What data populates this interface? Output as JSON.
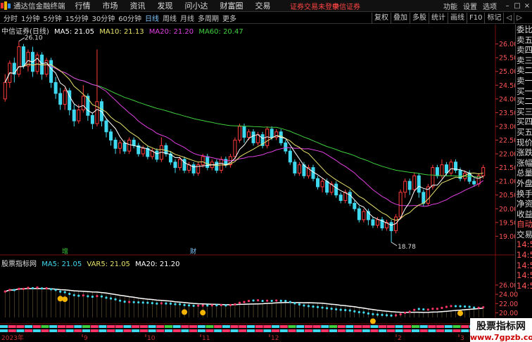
{
  "titlebar": {
    "app_title": "通达信金融终端",
    "menus": [
      "行情",
      "市场",
      "资讯",
      "发现",
      "问小达",
      "财富圈",
      "交易"
    ],
    "notice": "证券交易未登录",
    "broker": "中信证券",
    "right_menus": [
      "功能",
      "设置",
      "选项"
    ],
    "minimize": "–",
    "maximize": "□",
    "close": "×"
  },
  "toolbar": {
    "periods": [
      "分时",
      "1分钟",
      "5分钟",
      "15分钟",
      "30分钟",
      "60分钟",
      "日线",
      "周线",
      "月线",
      "多周期",
      "更多"
    ],
    "active_period": "日线",
    "tools": [
      "复权",
      "叠加",
      "多股",
      "统计",
      "画线",
      "F10",
      "标记",
      "◁",
      "▷"
    ]
  },
  "chart_title": {
    "stock": "中信证券(日线)",
    "ma5": "MA5: 21.05",
    "ma10": "MA10: 21.13",
    "ma20": "MA20: 21.20",
    "ma60": "MA60: 20.47"
  },
  "indicator_title": {
    "name": "股票指标网",
    "ma5": "MA5: 21.05",
    "var5": "VAR5: 21.05",
    "ma20": "MA20: 21.20"
  },
  "annotations": {
    "high": "26.10",
    "low": "18.78",
    "event1": "增",
    "event2": "财",
    "year": "2023年"
  },
  "x_labels": [
    "9",
    "10",
    "11",
    "12",
    "2",
    "3"
  ],
  "quote_panel": [
    "委比",
    "卖五",
    "卖四",
    "卖三",
    "卖二",
    "卖一",
    "买一",
    "买二",
    "买三",
    "买四",
    "买五",
    "现价",
    "涨跌",
    "涨幅",
    "总量",
    "外盘",
    "换手",
    "净资",
    "收益",
    "自动",
    "交易",
    "14:50",
    "14:50",
    "14:50",
    "14:50",
    "14:50",
    "14:50",
    "14:50",
    "14:50",
    "14:50"
  ],
  "watermark": {
    "line1": "股票指标网",
    "line2": "www.7gpzb.com"
  },
  "colors": {
    "up": "#ff3b3b",
    "down": "#3fd9ef",
    "ma5": "#ffffff",
    "ma10": "#e8e36a",
    "ma20": "#e040e0",
    "ma60": "#3ecf3e",
    "accent": "#7ec8ff"
  },
  "chart_data": [
    {
      "type": "candlestick",
      "title": "中信证券(日线)",
      "y_ticks": [
        26.0,
        25.5,
        25.0,
        24.5,
        24.0,
        23.5,
        23.0,
        22.5,
        22.0,
        21.5,
        21.0,
        20.5,
        20.0,
        19.5,
        19.0
      ],
      "ylim": [
        18.6,
        26.4
      ],
      "x_tick_labels": [
        "9",
        "10",
        "11",
        "12",
        "2",
        "3"
      ],
      "candles": [
        [
          24.0,
          24.6,
          24.9,
          23.9
        ],
        [
          24.6,
          25.3,
          25.4,
          24.4
        ],
        [
          25.3,
          24.9,
          25.5,
          24.6
        ],
        [
          24.9,
          25.9,
          26.1,
          24.8
        ],
        [
          25.9,
          25.2,
          26.0,
          25.1
        ],
        [
          25.2,
          25.7,
          25.8,
          25.0
        ],
        [
          25.7,
          25.0,
          25.9,
          24.8
        ],
        [
          25.0,
          25.6,
          25.7,
          24.9
        ],
        [
          25.6,
          24.9,
          25.7,
          24.7
        ],
        [
          24.9,
          25.4,
          25.5,
          24.8
        ],
        [
          25.4,
          24.6,
          25.5,
          24.4
        ],
        [
          24.6,
          24.2,
          24.8,
          24.0
        ],
        [
          24.2,
          23.8,
          24.4,
          23.6
        ],
        [
          23.8,
          24.3,
          24.4,
          23.6
        ],
        [
          24.3,
          23.6,
          24.4,
          23.4
        ],
        [
          23.6,
          23.2,
          23.8,
          23.0
        ],
        [
          23.2,
          23.6,
          23.8,
          23.1
        ],
        [
          23.6,
          24.1,
          24.5,
          23.5
        ],
        [
          24.1,
          23.4,
          24.2,
          23.2
        ],
        [
          23.4,
          23.1,
          23.5,
          22.9
        ],
        [
          23.1,
          23.9,
          25.8,
          23.0
        ],
        [
          23.9,
          23.2,
          24.0,
          23.0
        ],
        [
          23.2,
          22.8,
          23.3,
          22.6
        ],
        [
          22.8,
          22.5,
          22.9,
          22.3
        ],
        [
          22.5,
          22.2,
          22.6,
          22.0
        ],
        [
          22.2,
          22.4,
          22.5,
          22.0
        ],
        [
          22.4,
          22.1,
          22.5,
          22.0
        ],
        [
          22.1,
          22.5,
          22.6,
          22.0
        ],
        [
          22.5,
          22.3,
          22.6,
          22.2
        ],
        [
          22.3,
          22.0,
          22.4,
          21.9
        ],
        [
          22.0,
          22.2,
          22.3,
          21.9
        ],
        [
          22.2,
          21.9,
          22.3,
          21.8
        ],
        [
          21.9,
          22.1,
          22.2,
          21.8
        ],
        [
          22.1,
          21.8,
          22.2,
          21.7
        ],
        [
          21.8,
          22.3,
          22.6,
          21.7
        ],
        [
          22.3,
          22.0,
          22.4,
          21.9
        ],
        [
          22.0,
          21.7,
          22.1,
          21.6
        ],
        [
          21.7,
          21.5,
          21.8,
          21.3
        ],
        [
          21.5,
          21.8,
          21.9,
          21.4
        ],
        [
          21.8,
          21.4,
          21.9,
          21.3
        ],
        [
          21.4,
          21.6,
          21.7,
          21.3
        ],
        [
          21.6,
          21.3,
          21.7,
          21.2
        ],
        [
          21.3,
          21.6,
          21.7,
          21.2
        ],
        [
          21.6,
          21.9,
          22.0,
          21.5
        ],
        [
          21.9,
          21.5,
          22.0,
          21.4
        ],
        [
          21.5,
          21.7,
          21.8,
          21.4
        ],
        [
          21.7,
          21.4,
          21.8,
          21.3
        ],
        [
          21.4,
          21.8,
          21.9,
          21.3
        ],
        [
          21.8,
          21.6,
          21.9,
          21.5
        ],
        [
          21.6,
          21.9,
          22.0,
          21.5
        ],
        [
          21.9,
          22.5,
          22.6,
          21.8
        ],
        [
          22.5,
          23.0,
          23.1,
          22.4
        ],
        [
          23.0,
          22.6,
          23.1,
          22.4
        ],
        [
          22.6,
          22.8,
          22.9,
          22.5
        ],
        [
          22.8,
          22.4,
          22.9,
          22.3
        ],
        [
          22.4,
          22.7,
          22.8,
          22.3
        ],
        [
          22.7,
          22.3,
          22.8,
          22.2
        ],
        [
          22.3,
          22.9,
          23.0,
          22.2
        ],
        [
          22.9,
          22.6,
          23.0,
          22.5
        ],
        [
          22.6,
          22.8,
          22.9,
          22.5
        ],
        [
          22.8,
          22.4,
          22.9,
          22.3
        ],
        [
          22.4,
          22.1,
          22.5,
          22.0
        ],
        [
          22.1,
          21.7,
          22.2,
          21.6
        ],
        [
          21.7,
          21.3,
          21.8,
          21.2
        ],
        [
          21.3,
          21.6,
          21.7,
          21.2
        ],
        [
          21.6,
          21.2,
          21.7,
          21.1
        ],
        [
          21.2,
          21.5,
          21.6,
          21.1
        ],
        [
          21.5,
          21.1,
          21.6,
          21.0
        ],
        [
          21.1,
          20.8,
          21.2,
          20.7
        ],
        [
          20.8,
          21.0,
          21.1,
          20.6
        ],
        [
          21.0,
          20.6,
          21.1,
          20.5
        ],
        [
          20.6,
          20.9,
          21.0,
          20.5
        ],
        [
          20.9,
          20.5,
          21.0,
          20.4
        ],
        [
          20.5,
          20.3,
          20.6,
          20.2
        ],
        [
          20.3,
          20.6,
          20.7,
          20.2
        ],
        [
          20.6,
          20.2,
          20.7,
          20.1
        ],
        [
          20.2,
          20.0,
          20.3,
          19.9
        ],
        [
          20.0,
          19.6,
          20.1,
          19.5
        ],
        [
          19.6,
          19.9,
          20.0,
          19.5
        ],
        [
          19.9,
          19.6,
          20.0,
          19.4
        ],
        [
          19.6,
          19.4,
          19.7,
          19.3
        ],
        [
          19.4,
          19.6,
          19.7,
          19.3
        ],
        [
          19.6,
          19.3,
          19.7,
          19.2
        ],
        [
          19.3,
          19.5,
          19.6,
          19.2
        ],
        [
          19.5,
          19.2,
          19.6,
          18.78
        ],
        [
          19.2,
          19.7,
          19.8,
          19.1
        ],
        [
          19.7,
          20.6,
          20.7,
          19.6
        ],
        [
          20.6,
          21.0,
          21.1,
          20.4
        ],
        [
          21.0,
          20.7,
          21.1,
          20.5
        ],
        [
          20.7,
          21.2,
          21.3,
          20.6
        ],
        [
          21.2,
          20.6,
          21.3,
          20.4
        ],
        [
          20.6,
          20.2,
          20.7,
          20.1
        ],
        [
          20.2,
          20.8,
          20.9,
          20.1
        ],
        [
          20.8,
          21.5,
          21.6,
          20.7
        ],
        [
          21.5,
          21.2,
          21.6,
          21.1
        ],
        [
          21.2,
          21.6,
          21.8,
          21.1
        ],
        [
          21.6,
          21.3,
          21.7,
          21.2
        ],
        [
          21.3,
          21.7,
          21.8,
          21.2
        ],
        [
          21.7,
          21.4,
          21.8,
          21.3
        ],
        [
          21.4,
          21.1,
          21.5,
          21.0
        ],
        [
          21.1,
          21.3,
          21.4,
          21.0
        ],
        [
          21.3,
          21.0,
          21.4,
          20.9
        ],
        [
          21.0,
          20.9,
          21.1,
          20.8
        ],
        [
          20.9,
          21.2,
          21.3,
          20.8
        ],
        [
          21.2,
          21.5,
          21.6,
          21.1
        ]
      ]
    },
    {
      "type": "line",
      "title": "股票指标网",
      "y_ticks": [
        26.0,
        24.0,
        22.0,
        20.0
      ],
      "ylim": [
        19.0,
        26.6
      ]
    }
  ]
}
